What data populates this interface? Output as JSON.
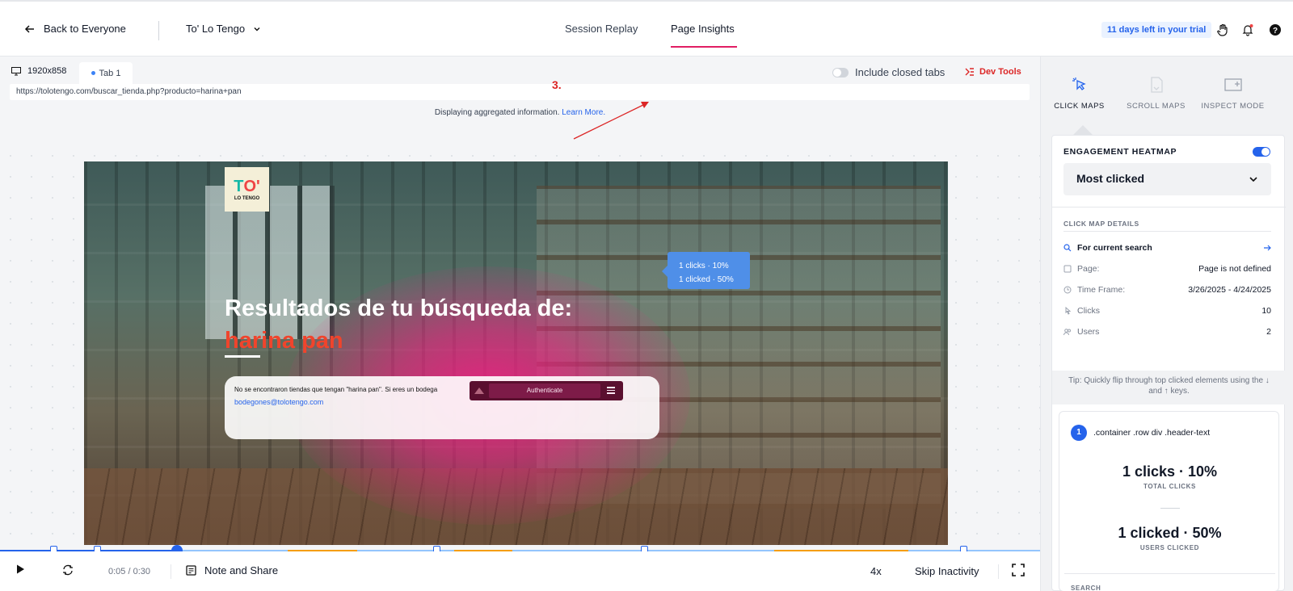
{
  "header": {
    "back_label": "Back to Everyone",
    "site_name": "To' Lo Tengo",
    "tabs": [
      {
        "label": "Session Replay"
      },
      {
        "label": "Page Insights"
      }
    ],
    "trial_badge": "11 days left in your trial"
  },
  "replay": {
    "resolution": "1920x858",
    "tab_label": "Tab 1",
    "include_closed_tabs": "Include closed tabs",
    "dev_tools": "Dev Tools",
    "url": "https://tolotengo.com/buscar_tienda.php?producto=harina+pan",
    "aggregated_text": "Displaying aggregated information.",
    "learn_more": "Learn More.",
    "annotation": "3."
  },
  "recorded_page": {
    "logo_mark_a": "T",
    "logo_mark_b": "O'",
    "logo_sub": "LO TENGO",
    "headline": "Resultados de tu búsqueda de:",
    "search_term": "harina pan",
    "message": "No se encontraron tiendas que tengan \"harina pan\". Si eres un bodega",
    "email": "bodegones@tolotengo.com",
    "auth_button": "Authenticate",
    "tooltip_line1": "1 clicks · 10%",
    "tooltip_line2": "1 clicked · 50%"
  },
  "controls": {
    "time": "0:05 / 0:30",
    "note_share": "Note and Share",
    "speed": "4x",
    "skip_inactivity": "Skip Inactivity",
    "progress": 0.17
  },
  "panel": {
    "modes": [
      {
        "label": "CLICK MAPS",
        "icon": "cursor-click-icon"
      },
      {
        "label": "SCROLL MAPS",
        "icon": "scroll-map-icon"
      },
      {
        "label": "INSPECT MODE",
        "icon": "inspect-plus-icon"
      }
    ],
    "engagement_heatmap": "ENGAGEMENT HEATMAP",
    "heatmap_select": "Most clicked",
    "details_label": "CLICK MAP DETAILS",
    "details": {
      "search": "For current search",
      "page_label": "Page:",
      "page_value": "Page is not defined",
      "timeframe_label": "Time Frame:",
      "timeframe_value": "3/26/2025 - 4/24/2025",
      "clicks_label": "Clicks",
      "clicks_value": "10",
      "users_label": "Users",
      "users_value": "2"
    },
    "tip": "Tip: Quickly flip through top clicked elements using the ↓ and ↑ keys.",
    "element": {
      "rank": "1",
      "selector": ".container .row div .header-text",
      "total_clicks": "1 clicks · 10%",
      "total_clicks_label": "TOTAL CLICKS",
      "users_clicked": "1 clicked · 50%",
      "users_clicked_label": "USERS CLICKED",
      "next_section": "SEARCH"
    }
  },
  "colors": {
    "accent": "#2563eb",
    "insights_underline": "#e11d63",
    "heat": "#ec2082",
    "annotation": "#dc2626"
  }
}
